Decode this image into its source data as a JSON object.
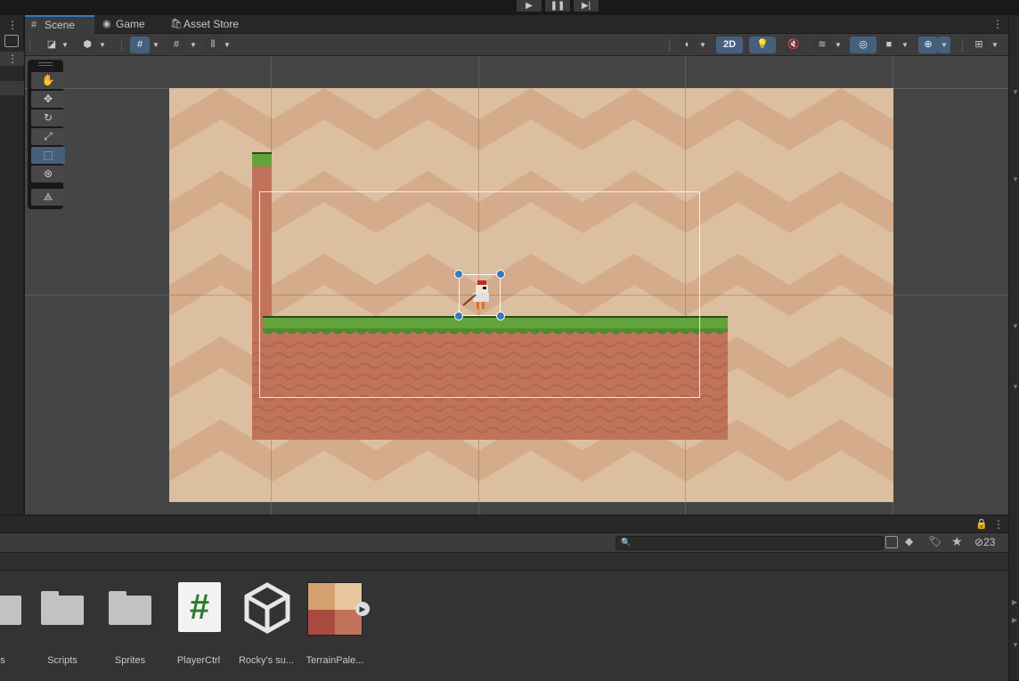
{
  "playbar": {
    "play": "▶",
    "pause": "❚❚",
    "step": "▶|"
  },
  "tabs": [
    {
      "label": "Scene",
      "icon": "#"
    },
    {
      "label": "Game",
      "icon": "◉"
    },
    {
      "label": "Asset Store",
      "icon": "🛍"
    }
  ],
  "toolbar": {
    "mode_2d": "2D"
  },
  "project": {
    "hidden_count": "23",
    "assets": [
      {
        "label": "es",
        "kind": "folder"
      },
      {
        "label": "Scripts",
        "kind": "folder"
      },
      {
        "label": "Sprites",
        "kind": "folder"
      },
      {
        "label": "PlayerCtrl",
        "kind": "script",
        "glyph": "#"
      },
      {
        "label": "Rocky's su...",
        "kind": "unity-prefab"
      },
      {
        "label": "TerrainPale...",
        "kind": "palette"
      }
    ]
  },
  "colors": {
    "accent": "#3a79bb",
    "sky": "#dcbfa0",
    "zigzag": "#d4ab8b",
    "grass": "#62a33b",
    "dirt": "#c0735a"
  }
}
